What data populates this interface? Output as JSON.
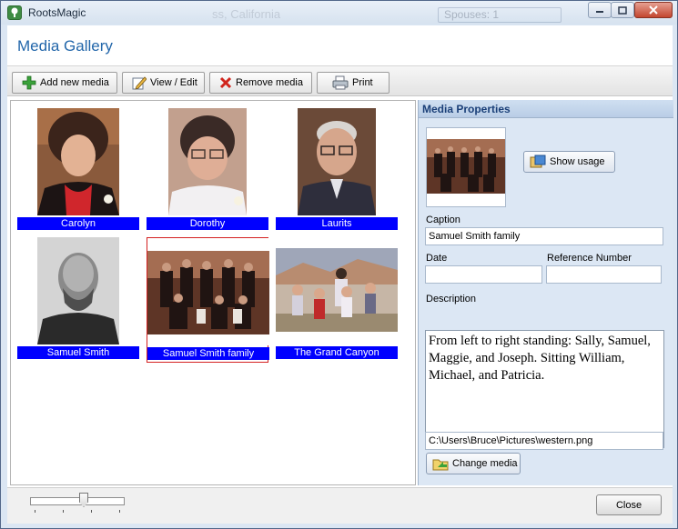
{
  "window": {
    "app_title": "RootsMagic",
    "background_ghost_text": "Spouses: 1",
    "background_ghost_text2": "ss, California"
  },
  "header": {
    "title": "Media Gallery"
  },
  "toolbar": {
    "add_label": "Add new media",
    "view_edit_label": "View / Edit",
    "remove_label": "Remove media",
    "print_label": "Print"
  },
  "gallery": {
    "items": [
      {
        "caption": "Carolyn",
        "icon": "portrait-photo"
      },
      {
        "caption": "Dorothy",
        "icon": "portrait-photo"
      },
      {
        "caption": "Laurits",
        "icon": "portrait-photo"
      },
      {
        "caption": "Samuel Smith",
        "icon": "bw-portrait-photo"
      },
      {
        "caption": "Samuel Smith family",
        "icon": "group-photo",
        "selected": true
      },
      {
        "caption": "The Grand Canyon",
        "icon": "landscape-photo"
      }
    ]
  },
  "properties": {
    "title": "Media Properties",
    "show_usage_label": "Show usage",
    "caption_label": "Caption",
    "caption_value": "Samuel Smith family",
    "date_label": "Date",
    "date_value": "",
    "refnum_label": "Reference Number",
    "refnum_value": "",
    "description_label": "Description",
    "description_value": "From left to right standing: Sally, Samuel, Maggie, and Joseph.  Sitting William, Michael, and Patricia.",
    "file_path": "C:\\Users\\Bruce\\Pictures\\western.png",
    "change_media_label": "Change media"
  },
  "footer": {
    "close_label": "Close",
    "zoom_slider_level": 0.55
  },
  "colors": {
    "caption_bg": "#0000ff",
    "header_title": "#2266aa",
    "selected_border": "#d42020"
  }
}
